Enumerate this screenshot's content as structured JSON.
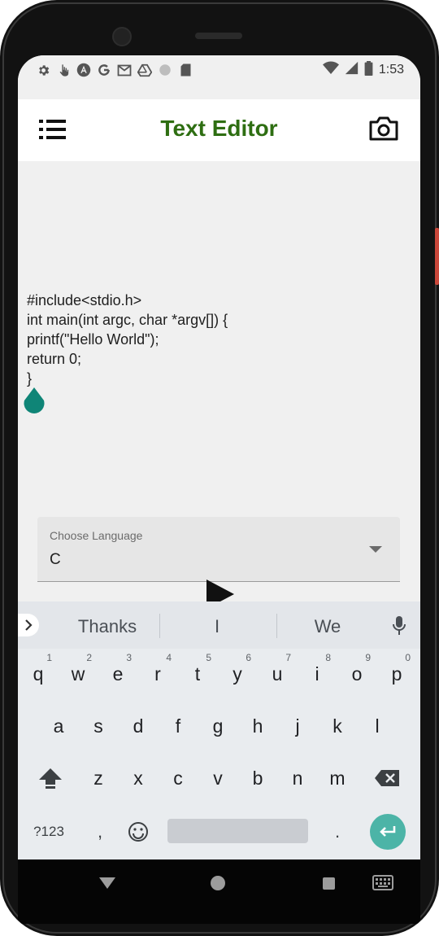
{
  "status_bar": {
    "time": "1:53",
    "left_icons": [
      "gear-icon",
      "hand-touch-icon",
      "angular-icon",
      "google-icon",
      "gmail-icon",
      "drive-icon",
      "circle-icon",
      "sd-card-icon"
    ],
    "right_icons": [
      "wifi-icon",
      "signal-icon",
      "battery-icon"
    ]
  },
  "app_bar": {
    "title": "Text Editor",
    "title_color": "#2e6e12",
    "menu_icon": "list-menu-icon",
    "camera_icon": "camera-icon"
  },
  "editor": {
    "lines": [
      "#include<stdio.h>",
      "int main(int argc, char *argv[]) {",
      "printf(\"Hello World\");",
      "return 0;",
      "}"
    ],
    "cursor_handle_color": "#0f8577"
  },
  "language_select": {
    "label": "Choose Language",
    "value": "C"
  },
  "run_button": {
    "icon": "play-icon"
  },
  "keyboard": {
    "suggestions": [
      "Thanks",
      "I",
      "We"
    ],
    "rows": [
      [
        {
          "k": "q",
          "n": "1"
        },
        {
          "k": "w",
          "n": "2"
        },
        {
          "k": "e",
          "n": "3"
        },
        {
          "k": "r",
          "n": "4"
        },
        {
          "k": "t",
          "n": "5"
        },
        {
          "k": "y",
          "n": "6"
        },
        {
          "k": "u",
          "n": "7"
        },
        {
          "k": "i",
          "n": "8"
        },
        {
          "k": "o",
          "n": "9"
        },
        {
          "k": "p",
          "n": "0"
        }
      ],
      [
        {
          "k": "a"
        },
        {
          "k": "s"
        },
        {
          "k": "d"
        },
        {
          "k": "f"
        },
        {
          "k": "g"
        },
        {
          "k": "h"
        },
        {
          "k": "j"
        },
        {
          "k": "k"
        },
        {
          "k": "l"
        }
      ],
      [
        {
          "k": "z"
        },
        {
          "k": "x"
        },
        {
          "k": "c"
        },
        {
          "k": "v"
        },
        {
          "k": "b"
        },
        {
          "k": "n"
        },
        {
          "k": "m"
        }
      ]
    ],
    "symbols_label": "?123",
    "comma": ",",
    "period": ".",
    "enter_color": "#4cb4a7"
  },
  "nav_bar": {
    "icons": [
      "back-icon",
      "home-icon",
      "recents-icon",
      "keyboard-switch-icon"
    ]
  }
}
